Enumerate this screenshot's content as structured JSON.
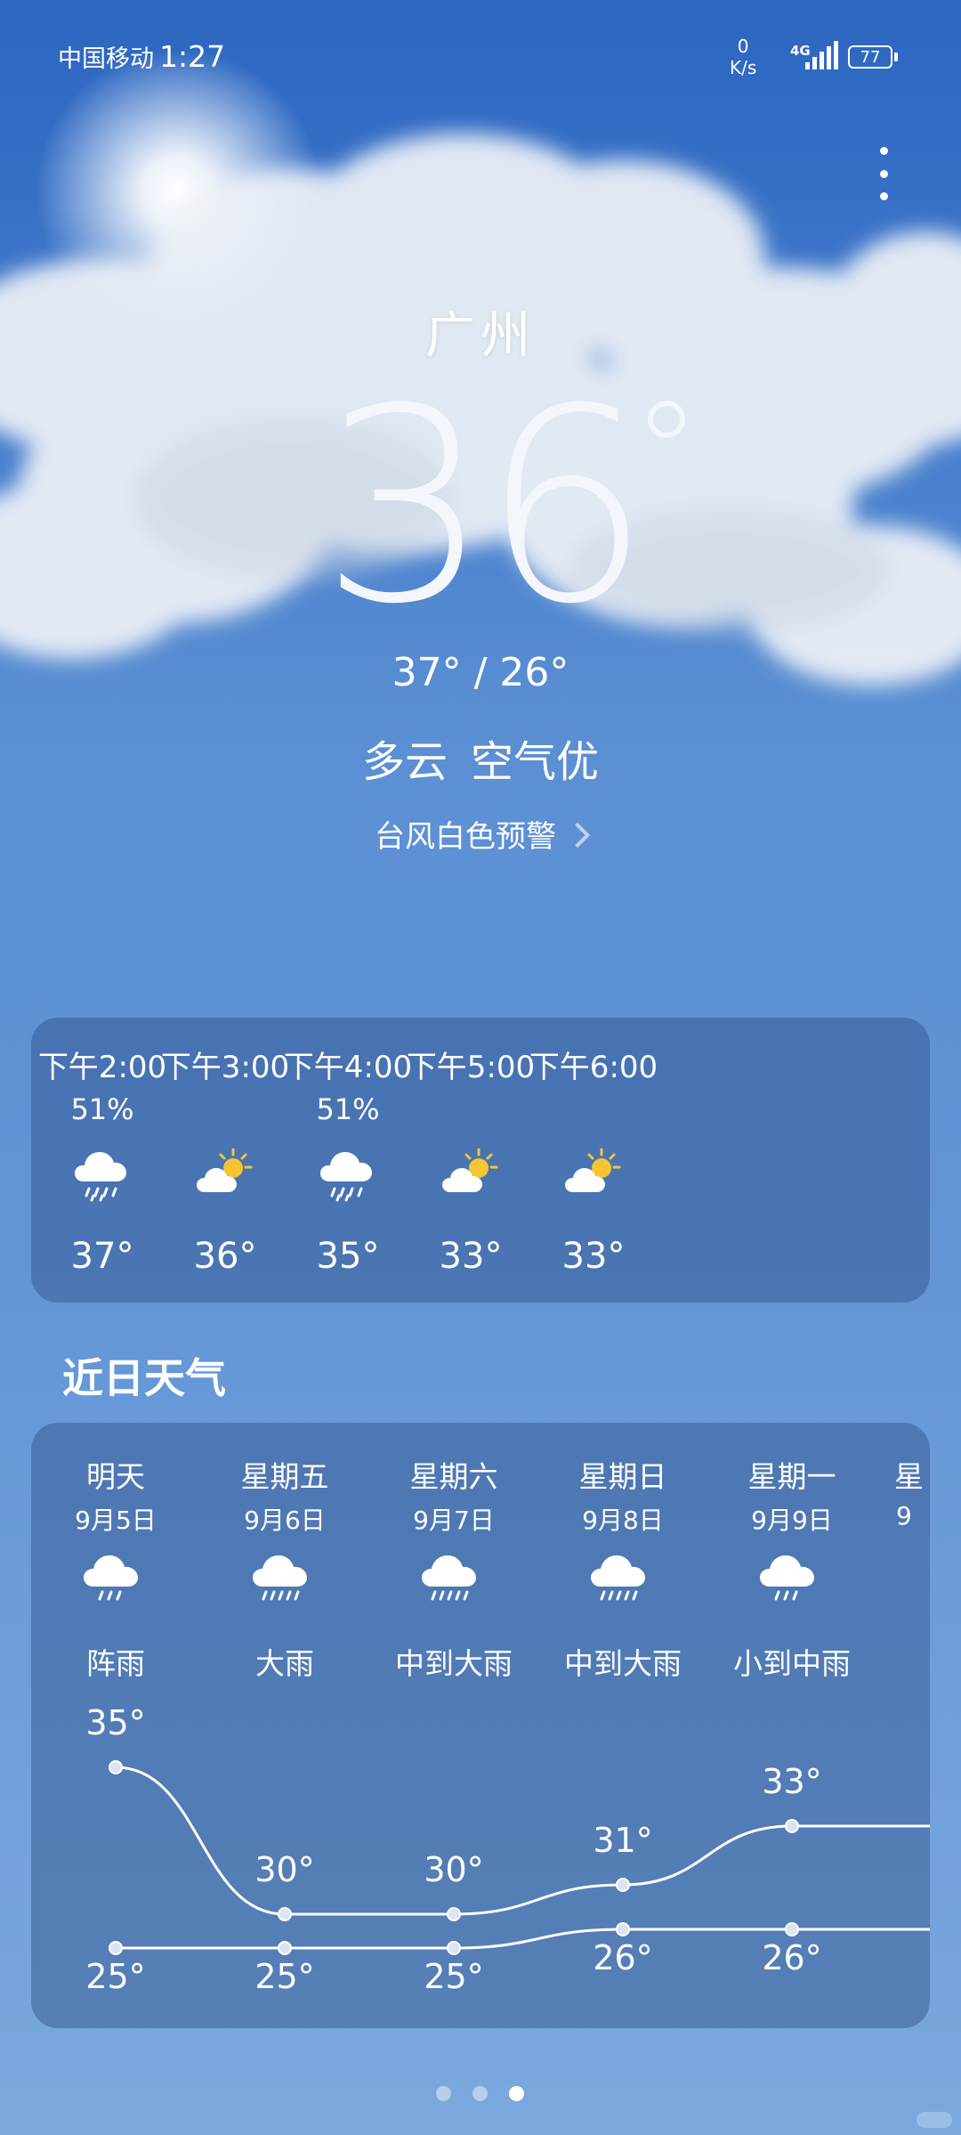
{
  "status_bar": {
    "carrier": "中国移动",
    "time": "1:27",
    "net_speed_value": "0",
    "net_speed_unit": "K/s",
    "network": "4G",
    "battery": "77"
  },
  "current": {
    "city": "广州",
    "temperature": "36",
    "high_low": "37° / 26°",
    "condition": "多云",
    "air_quality": "空气优",
    "alert": "台风白色预警"
  },
  "hourly": [
    {
      "time": "下午2:00",
      "precip": "51%",
      "icon": "rain-cloud-icon",
      "temp": "37°"
    },
    {
      "time": "下午3:00",
      "precip": "",
      "icon": "partly-sunny-icon",
      "temp": "36°"
    },
    {
      "time": "下午4:00",
      "precip": "51%",
      "icon": "rain-cloud-icon",
      "temp": "35°"
    },
    {
      "time": "下午5:00",
      "precip": "",
      "icon": "partly-sunny-icon",
      "temp": "33°"
    },
    {
      "time": "下午6:00",
      "precip": "",
      "icon": "partly-sunny-icon",
      "temp": "33°"
    }
  ],
  "daily_title": "近日天气",
  "daily": [
    {
      "name": "明天",
      "date": "9月5日",
      "icon": "rain-cloud-icon",
      "weather": "阵雨",
      "high": "35°",
      "low": "25°"
    },
    {
      "name": "星期五",
      "date": "9月6日",
      "icon": "heavy-rain-icon",
      "weather": "大雨",
      "high": "30°",
      "low": "25°"
    },
    {
      "name": "星期六",
      "date": "9月7日",
      "icon": "heavy-rain-icon",
      "weather": "中到大雨",
      "high": "30°",
      "low": "25°"
    },
    {
      "name": "星期日",
      "date": "9月8日",
      "icon": "heavy-rain-icon",
      "weather": "中到大雨",
      "high": "31°",
      "low": "26°"
    },
    {
      "name": "星期一",
      "date": "9月9日",
      "icon": "rain-cloud-icon",
      "weather": "小到中雨",
      "high": "33°",
      "low": "26°"
    },
    {
      "name": "星",
      "date": "9",
      "icon": "",
      "weather": "",
      "high": "",
      "low": ""
    }
  ],
  "daily_high_values": [
    35,
    30,
    30,
    31,
    33,
    33
  ],
  "daily_low_values": [
    25,
    25,
    25,
    26,
    26,
    26
  ],
  "pager": {
    "count": 3,
    "active": 2
  },
  "colors": {
    "sky_top": "#2f6fc8",
    "sky_bottom": "#7aa8de",
    "card_bg": "rgba(38,70,125,0.40)",
    "sun": "#f7c531"
  }
}
